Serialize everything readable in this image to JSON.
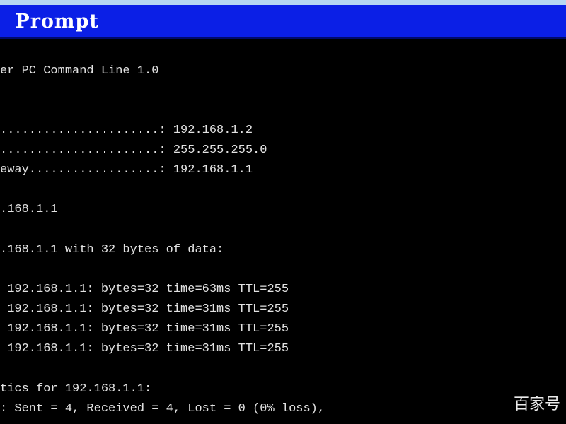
{
  "window": {
    "title": " Prompt"
  },
  "console": {
    "lines": [
      "er PC Command Line 1.0",
      "",
      "......................: 192.168.1.2",
      "......................: 255.255.255.0",
      "eway..................: 192.168.1.1",
      ".168.1.1",
      ".168.1.1 with 32 bytes of data:",
      " 192.168.1.1: bytes=32 time=63ms TTL=255",
      " 192.168.1.1: bytes=32 time=31ms TTL=255",
      " 192.168.1.1: bytes=32 time=31ms TTL=255",
      " 192.168.1.1: bytes=32 time=31ms TTL=255",
      "tics for 192.168.1.1:",
      ": Sent = 4, Received = 4, Lost = 0 (0% loss),"
    ]
  },
  "watermark": {
    "text": "百家号"
  }
}
